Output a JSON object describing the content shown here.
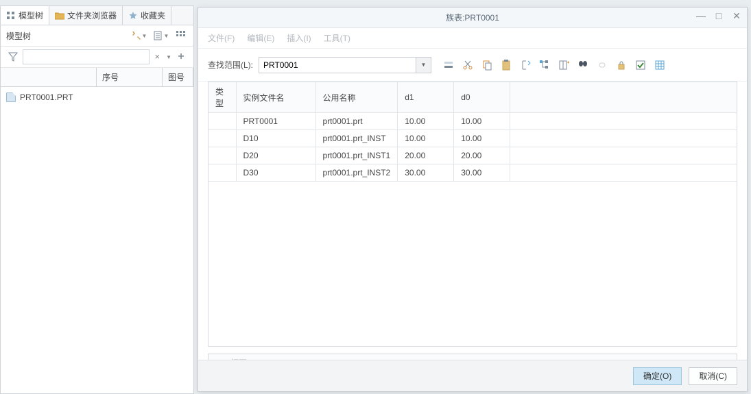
{
  "left": {
    "tabs": [
      {
        "label": "模型树",
        "icon": "tree"
      },
      {
        "label": "文件夹浏览器",
        "icon": "folder"
      },
      {
        "label": "收藏夹",
        "icon": "star"
      }
    ],
    "toolbarLabel": "模型树",
    "treeHeader": {
      "seq": "序号",
      "fig": "图号"
    },
    "items": [
      {
        "label": "PRT0001.PRT"
      }
    ]
  },
  "dialog": {
    "title": "族表:PRT0001",
    "menus": [
      "文件(F)",
      "编辑(E)",
      "插入(I)",
      "工具(T)"
    ],
    "searchLabel": "查找范围(L):",
    "searchValue": "PRT0001",
    "columns": {
      "type": "类型",
      "name": "实例文件名",
      "pub": "公用名称",
      "d1": "d1",
      "d0": "d0"
    },
    "rows": [
      {
        "type": "",
        "name": "PRT0001",
        "pub": "prt0001.prt",
        "d1": "10.00",
        "d0": "10.00"
      },
      {
        "type": "",
        "name": "D10",
        "pub": "prt0001.prt_INST",
        "d1": "10.00",
        "d0": "10.00"
      },
      {
        "type": "",
        "name": "D20",
        "pub": "prt0001.prt_INST1",
        "d1": "20.00",
        "d0": "20.00"
      },
      {
        "type": "",
        "name": "D30",
        "pub": "prt0001.prt_INST2",
        "d1": "30.00",
        "d0": "30.00"
      }
    ],
    "openLabel": "打开(P)",
    "ok": "确定(O)",
    "cancel": "取消(C)"
  }
}
